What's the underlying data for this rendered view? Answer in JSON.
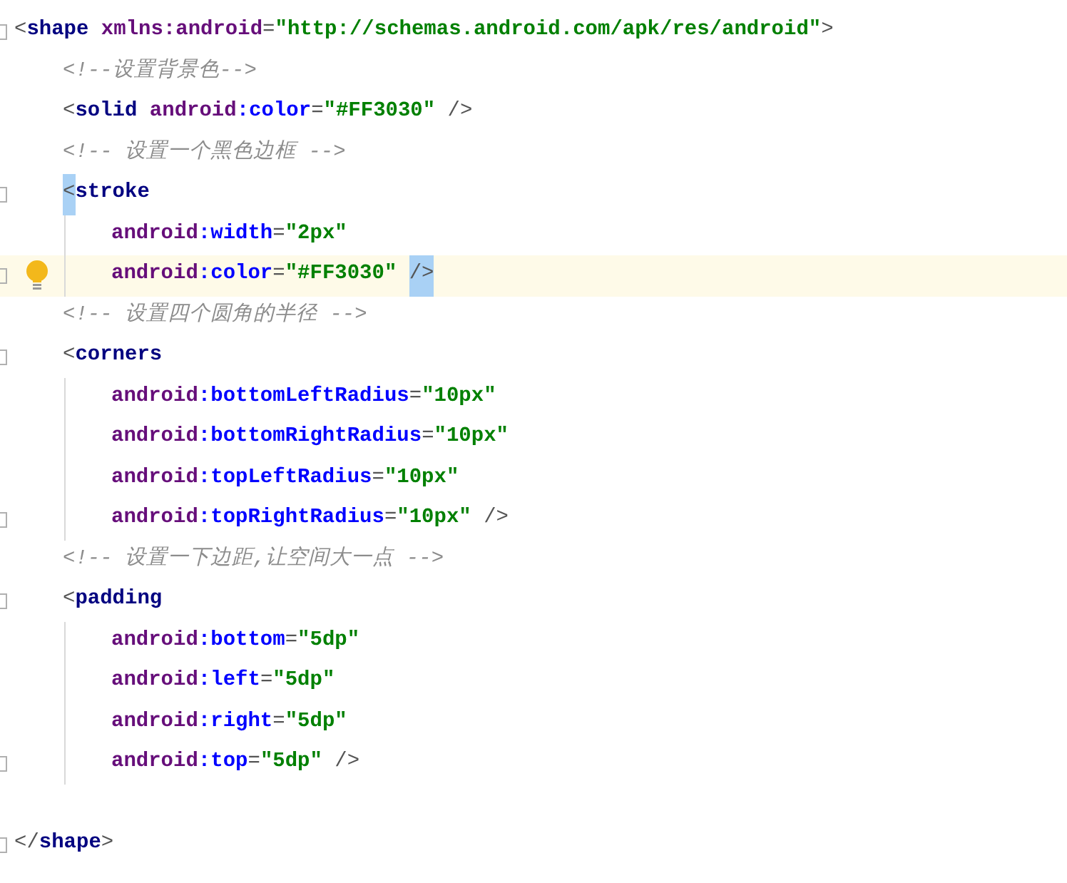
{
  "editor": {
    "lines": [
      {
        "foldable": true,
        "current": false,
        "intention": false,
        "tokens": [
          {
            "kind": "punct",
            "text": "<",
            "matched": false
          },
          {
            "kind": "tag",
            "text": "shape",
            "matched": false
          },
          {
            "kind": "ns",
            "text": " xmlns:android",
            "matched": false
          },
          {
            "kind": "punct",
            "text": "=",
            "matched": false
          },
          {
            "kind": "value",
            "text": "\"http://schemas.android.com/apk/res/android\"",
            "matched": false
          },
          {
            "kind": "punct",
            "text": ">",
            "matched": false
          }
        ],
        "children": [
          {
            "foldable": false,
            "current": false,
            "intention": false,
            "tokens": [
              {
                "kind": "comment",
                "text": "<!--设置背景色-->",
                "matched": false
              }
            ]
          },
          {
            "foldable": false,
            "current": false,
            "intention": false,
            "tokens": [
              {
                "kind": "punct",
                "text": "<",
                "matched": false
              },
              {
                "kind": "tag",
                "text": "solid",
                "matched": false
              },
              {
                "kind": "ns",
                "text": " android",
                "matched": false
              },
              {
                "kind": "attr",
                "text": ":color",
                "matched": false
              },
              {
                "kind": "punct",
                "text": "=",
                "matched": false
              },
              {
                "kind": "value",
                "text": "\"#FF3030\"",
                "matched": false
              },
              {
                "kind": "punct",
                "text": " />",
                "matched": false
              }
            ]
          },
          {
            "foldable": false,
            "current": false,
            "intention": false,
            "tokens": [
              {
                "kind": "comment",
                "text": "<!-- 设置一个黑色边框 -->",
                "matched": false
              }
            ]
          },
          {
            "foldable": true,
            "current": false,
            "intention": false,
            "tokens": [
              {
                "kind": "punct",
                "text": "<",
                "matched": true
              },
              {
                "kind": "tag",
                "text": "stroke",
                "matched": false
              }
            ],
            "children": [
              {
                "foldable": false,
                "current": false,
                "intention": false,
                "tokens": [
                  {
                    "kind": "ns",
                    "text": "android",
                    "matched": false
                  },
                  {
                    "kind": "attr",
                    "text": ":width",
                    "matched": false
                  },
                  {
                    "kind": "punct",
                    "text": "=",
                    "matched": false
                  },
                  {
                    "kind": "value",
                    "text": "\"2px\"",
                    "matched": false
                  }
                ]
              },
              {
                "foldable": true,
                "current": true,
                "intention": true,
                "tokens": [
                  {
                    "kind": "ns",
                    "text": "android",
                    "matched": false
                  },
                  {
                    "kind": "attr",
                    "text": ":color",
                    "matched": false
                  },
                  {
                    "kind": "punct",
                    "text": "=",
                    "matched": false
                  },
                  {
                    "kind": "value",
                    "text": "\"#FF3030\" ",
                    "matched": false
                  },
                  {
                    "kind": "punct",
                    "text": "/>",
                    "matched": true
                  }
                ]
              }
            ]
          },
          {
            "foldable": false,
            "current": false,
            "intention": false,
            "tokens": [
              {
                "kind": "comment",
                "text": "<!-- 设置四个圆角的半径 -->",
                "matched": false
              }
            ]
          },
          {
            "foldable": true,
            "current": false,
            "intention": false,
            "tokens": [
              {
                "kind": "punct",
                "text": "<",
                "matched": false
              },
              {
                "kind": "tag",
                "text": "corners",
                "matched": false
              }
            ],
            "children": [
              {
                "foldable": false,
                "current": false,
                "intention": false,
                "tokens": [
                  {
                    "kind": "ns",
                    "text": "android",
                    "matched": false
                  },
                  {
                    "kind": "attr",
                    "text": ":bottomLeftRadius",
                    "matched": false
                  },
                  {
                    "kind": "punct",
                    "text": "=",
                    "matched": false
                  },
                  {
                    "kind": "value",
                    "text": "\"10px\"",
                    "matched": false
                  }
                ]
              },
              {
                "foldable": false,
                "current": false,
                "intention": false,
                "tokens": [
                  {
                    "kind": "ns",
                    "text": "android",
                    "matched": false
                  },
                  {
                    "kind": "attr",
                    "text": ":bottomRightRadius",
                    "matched": false
                  },
                  {
                    "kind": "punct",
                    "text": "=",
                    "matched": false
                  },
                  {
                    "kind": "value",
                    "text": "\"10px\"",
                    "matched": false
                  }
                ]
              },
              {
                "foldable": false,
                "current": false,
                "intention": false,
                "tokens": [
                  {
                    "kind": "ns",
                    "text": "android",
                    "matched": false
                  },
                  {
                    "kind": "attr",
                    "text": ":topLeftRadius",
                    "matched": false
                  },
                  {
                    "kind": "punct",
                    "text": "=",
                    "matched": false
                  },
                  {
                    "kind": "value",
                    "text": "\"10px\"",
                    "matched": false
                  }
                ]
              },
              {
                "foldable": true,
                "current": false,
                "intention": false,
                "tokens": [
                  {
                    "kind": "ns",
                    "text": "android",
                    "matched": false
                  },
                  {
                    "kind": "attr",
                    "text": ":topRightRadius",
                    "matched": false
                  },
                  {
                    "kind": "punct",
                    "text": "=",
                    "matched": false
                  },
                  {
                    "kind": "value",
                    "text": "\"10px\"",
                    "matched": false
                  },
                  {
                    "kind": "punct",
                    "text": " />",
                    "matched": false
                  }
                ]
              }
            ]
          },
          {
            "foldable": false,
            "current": false,
            "intention": false,
            "tokens": [
              {
                "kind": "comment",
                "text": "<!-- 设置一下边距,让空间大一点 -->",
                "matched": false
              }
            ]
          },
          {
            "foldable": true,
            "current": false,
            "intention": false,
            "tokens": [
              {
                "kind": "punct",
                "text": "<",
                "matched": false
              },
              {
                "kind": "tag",
                "text": "padding",
                "matched": false
              }
            ],
            "children": [
              {
                "foldable": false,
                "current": false,
                "intention": false,
                "tokens": [
                  {
                    "kind": "ns",
                    "text": "android",
                    "matched": false
                  },
                  {
                    "kind": "attr",
                    "text": ":bottom",
                    "matched": false
                  },
                  {
                    "kind": "punct",
                    "text": "=",
                    "matched": false
                  },
                  {
                    "kind": "value",
                    "text": "\"5dp\"",
                    "matched": false
                  }
                ]
              },
              {
                "foldable": false,
                "current": false,
                "intention": false,
                "tokens": [
                  {
                    "kind": "ns",
                    "text": "android",
                    "matched": false
                  },
                  {
                    "kind": "attr",
                    "text": ":left",
                    "matched": false
                  },
                  {
                    "kind": "punct",
                    "text": "=",
                    "matched": false
                  },
                  {
                    "kind": "value",
                    "text": "\"5dp\"",
                    "matched": false
                  }
                ]
              },
              {
                "foldable": false,
                "current": false,
                "intention": false,
                "tokens": [
                  {
                    "kind": "ns",
                    "text": "android",
                    "matched": false
                  },
                  {
                    "kind": "attr",
                    "text": ":right",
                    "matched": false
                  },
                  {
                    "kind": "punct",
                    "text": "=",
                    "matched": false
                  },
                  {
                    "kind": "value",
                    "text": "\"5dp\"",
                    "matched": false
                  }
                ]
              },
              {
                "foldable": true,
                "current": false,
                "intention": false,
                "tokens": [
                  {
                    "kind": "ns",
                    "text": "android",
                    "matched": false
                  },
                  {
                    "kind": "attr",
                    "text": ":top",
                    "matched": false
                  },
                  {
                    "kind": "punct",
                    "text": "=",
                    "matched": false
                  },
                  {
                    "kind": "value",
                    "text": "\"5dp\"",
                    "matched": false
                  },
                  {
                    "kind": "punct",
                    "text": " />",
                    "matched": false
                  }
                ]
              }
            ]
          }
        ]
      },
      {
        "foldable": true,
        "current": false,
        "intention": false,
        "tokens": [
          {
            "kind": "punct",
            "text": "</",
            "matched": false
          },
          {
            "kind": "tag",
            "text": "shape",
            "matched": false
          },
          {
            "kind": "punct",
            "text": ">",
            "matched": false
          }
        ]
      }
    ]
  }
}
